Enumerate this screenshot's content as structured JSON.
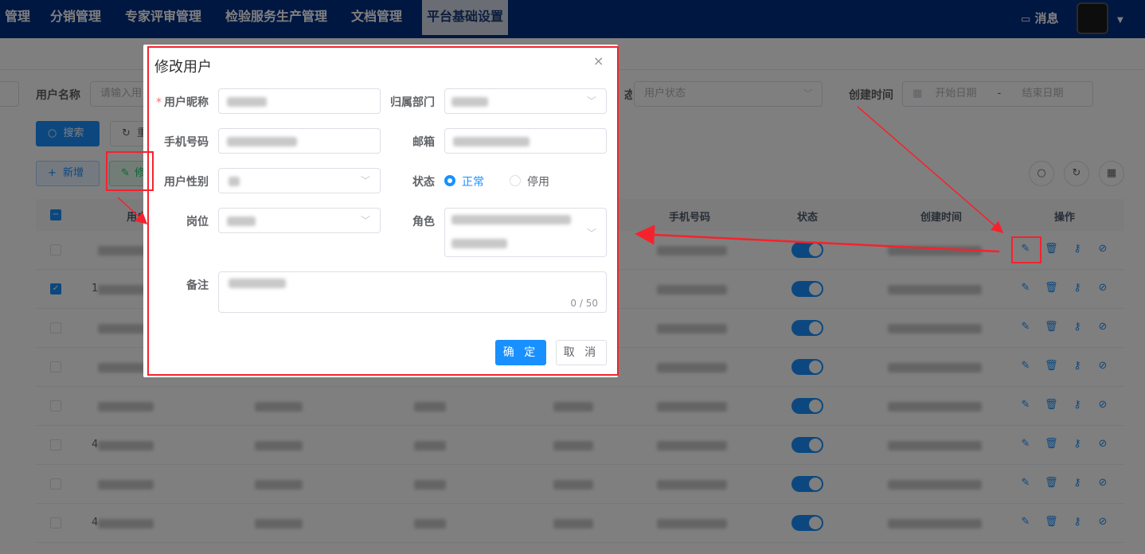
{
  "nav": {
    "menus": [
      "管理",
      "分销管理",
      "专家评审管理",
      "检验服务生产管理",
      "文档管理",
      "平台基础设置"
    ],
    "active_index": 5,
    "messages_label": "消息"
  },
  "filters": {
    "username_label": "用户名称",
    "username_placeholder": "请输入用",
    "status_partial_label": "态",
    "status_placeholder": "用户状态",
    "created_label": "创建时间",
    "start_placeholder": "开始日期",
    "range_sep": "-",
    "end_placeholder": "结束日期"
  },
  "toolbar": {
    "search": "搜索",
    "reset_partial": "重",
    "add": "新增",
    "edit_partial": "修"
  },
  "table": {
    "headers": {
      "username_partial": "用户",
      "phone": "手机号码",
      "status": "状态",
      "created": "创建时间",
      "actions": "操作"
    },
    "rows": [
      {
        "checked": false,
        "status_on": true,
        "id_text": ""
      },
      {
        "checked": true,
        "status_on": true,
        "id_text": "1"
      },
      {
        "checked": false,
        "status_on": true,
        "id_text": ""
      },
      {
        "checked": false,
        "status_on": true,
        "id_text": ""
      },
      {
        "checked": false,
        "status_on": true,
        "id_text": ""
      },
      {
        "checked": false,
        "status_on": true,
        "id_text": "4"
      },
      {
        "checked": false,
        "status_on": true,
        "id_text": ""
      },
      {
        "checked": false,
        "status_on": true,
        "id_text": "4"
      }
    ]
  },
  "dialog": {
    "title": "修改用户",
    "close": "×",
    "nickname_label": "用户昵称",
    "required_mark": "*",
    "dept_label": "归属部门",
    "phone_label": "手机号码",
    "email_label": "邮箱",
    "gender_label": "用户性别",
    "status_label": "状态",
    "status_normal": "正常",
    "status_disabled": "停用",
    "status_selected": "正常",
    "post_label": "岗位",
    "role_label": "角色",
    "remark_label": "备注",
    "remark_counter": "0 / 50",
    "confirm": "确 定",
    "cancel": "取 消"
  },
  "colors": {
    "nav_bg": "#002f82",
    "primary": "#1890ff",
    "annotation": "#f5222d"
  },
  "icons": [
    "message-icon",
    "caret-down-icon",
    "search-icon",
    "refresh-icon",
    "plus-icon",
    "edit-icon",
    "delete-icon",
    "key-icon",
    "check-circle-icon",
    "grid-icon",
    "close-icon",
    "chevron-down-icon",
    "calendar-icon"
  ]
}
